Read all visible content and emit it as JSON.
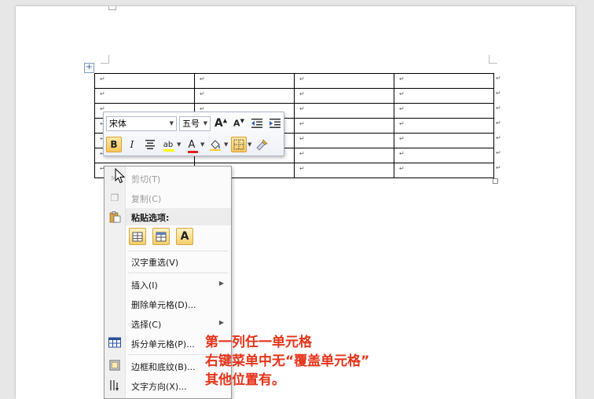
{
  "document": {
    "paragraph_mark": "↵",
    "table": {
      "rows": 7,
      "columns": 4
    }
  },
  "mini_toolbar": {
    "font_name": "宋体",
    "font_size": "五号",
    "grow_font_label": "A",
    "shrink_font_label": "A",
    "bold_label": "B",
    "italic_label": "I",
    "highlight_label": "ab",
    "font_color_label": "A",
    "font_color": "#e02020",
    "highlight_color": "#ffff00"
  },
  "context_menu": {
    "items": [
      {
        "label": "剪切(T)",
        "icon": "scissors-icon",
        "disabled": true
      },
      {
        "label": "复制(C)",
        "icon": "copy-icon",
        "disabled": true
      },
      {
        "label": "粘贴选项:",
        "icon": "paste-icon",
        "header": true
      },
      {
        "label": "汉字重选(V)"
      },
      {
        "label": "插入(I)",
        "submenu": true
      },
      {
        "label": "删除单元格(D)..."
      },
      {
        "label": "选择(C)",
        "submenu": true
      },
      {
        "label": "拆分单元格(P)...",
        "icon": "split-cells-icon"
      },
      {
        "label": "边框和底纹(B)...",
        "icon": "borders-icon"
      },
      {
        "label": "文字方向(X)...",
        "icon": "text-direction-icon"
      }
    ],
    "paste_options": [
      "keep-source-formatting-icon",
      "merge-formatting-icon",
      "keep-text-only-icon"
    ],
    "paste_text_only_label": "A"
  },
  "annotation": {
    "line1": "第一列任一单元格",
    "line2": "右键菜单中无“覆盖单元格”",
    "line3": "其他位置有。",
    "color": "#e53319"
  }
}
